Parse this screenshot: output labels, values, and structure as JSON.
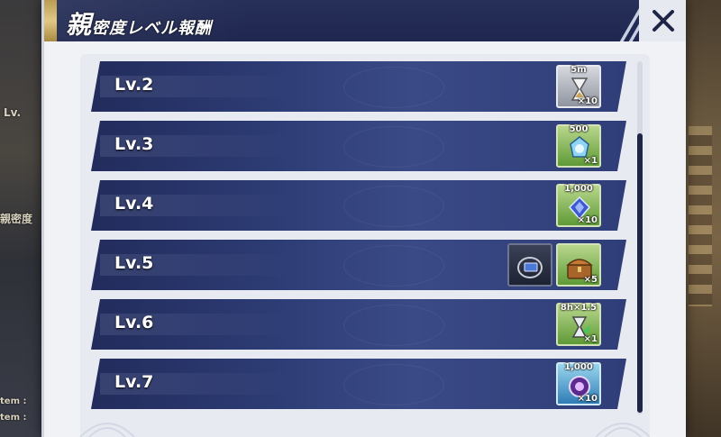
{
  "background": {
    "left_fragments": [
      "Lv.",
      "親密度",
      "tem :",
      "tem :"
    ]
  },
  "dialog": {
    "title_big": "親",
    "title_rest": "密度レベル報酬"
  },
  "rows": [
    {
      "level": "Lv.2",
      "rewards": [
        {
          "top": "5m",
          "count": "×10",
          "style": "gray",
          "icon": "hourglass-icon"
        }
      ]
    },
    {
      "level": "Lv.3",
      "rewards": [
        {
          "top": "500",
          "count": "×1",
          "style": "green",
          "icon": "crystal-lantern-icon"
        }
      ]
    },
    {
      "level": "Lv.4",
      "rewards": [
        {
          "top": "1,000",
          "count": "×10",
          "style": "green",
          "icon": "blue-gem-icon"
        }
      ]
    },
    {
      "level": "Lv.5",
      "rewards": [
        {
          "top": "",
          "count": "",
          "style": "dark",
          "icon": "nameplate-frame-icon"
        },
        {
          "top": "",
          "count": "×5",
          "style": "green",
          "icon": "treasure-chest-icon"
        }
      ]
    },
    {
      "level": "Lv.6",
      "rewards": [
        {
          "top": "8h×1.5",
          "count": "×1",
          "style": "green",
          "icon": "boost-hourglass-icon"
        }
      ]
    },
    {
      "level": "Lv.7",
      "rewards": [
        {
          "top": "1,000",
          "count": "×10",
          "style": "blue",
          "icon": "purple-orb-icon"
        }
      ]
    }
  ],
  "scroll": {
    "position_fraction": 0.2
  }
}
